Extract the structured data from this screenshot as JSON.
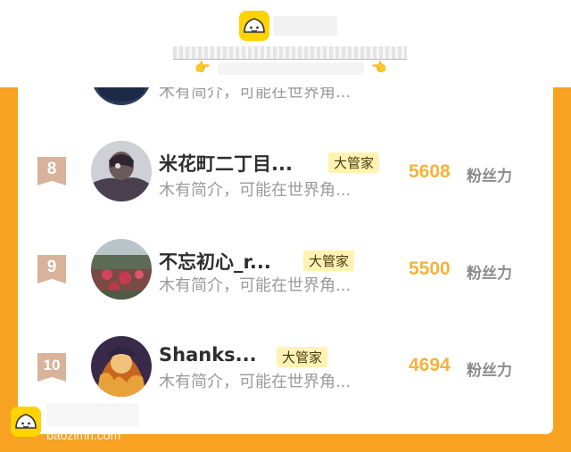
{
  "header": {
    "logo_icon": "baozi-bun-icon",
    "pointer_icon": "pointing-hand-icon",
    "left_pointer": "👉",
    "right_pointer": "👈"
  },
  "partial_row": {
    "desc": "木有简介，可能在世界角..."
  },
  "rows": [
    {
      "rank": "8",
      "name": "米花町二丁目...",
      "tag": "大管家",
      "desc": "木有简介，可能在世界角...",
      "count": "5608",
      "unit": "粉丝力",
      "avatar": "avatar-masked-character"
    },
    {
      "rank": "9",
      "name": "不忘初心_r...",
      "tag": "大管家",
      "desc": "木有简介，可能在世界角...",
      "count": "5500",
      "unit": "粉丝力",
      "avatar": "avatar-flower-field"
    },
    {
      "rank": "10",
      "name": "Shanks...",
      "tag": "大管家",
      "desc": "木有简介，可能在世界角...",
      "count": "4694",
      "unit": "粉丝力",
      "avatar": "avatar-anime-fire"
    }
  ],
  "footer": {
    "watermark": "baozimh.com",
    "logo_icon": "baozi-bun-icon"
  },
  "colors": {
    "accent_orange": "#f7a223",
    "logo_yellow": "#ffd300",
    "count_gold": "#f3b33d",
    "badge_tan": "#d8b39a",
    "tag_bg": "#fff3b3"
  }
}
